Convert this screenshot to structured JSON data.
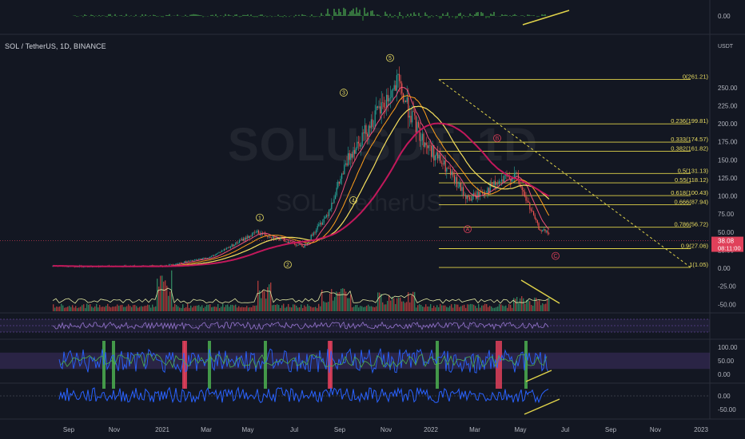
{
  "header": {
    "symbol_line": "SOL / TetherUS, 1D, BINANCE",
    "watermark_ticker": "SOLUSDT, 1D",
    "watermark_desc": "SOL / TetherUS",
    "currency": "USDT"
  },
  "colors": {
    "background": "#131722",
    "fib_line": "#e0d34a",
    "fib_label": "#e8dc62",
    "price_label_bg": "#e0405a",
    "candle_up": "#26a69a",
    "candle_down": "#ef5350",
    "ma_fast": "#f0507a",
    "ma_mid": "#ff9f1c",
    "ma_slow": "#f6e05e",
    "ma_long": "#c2185b",
    "oscillator_blue": "#2962ff",
    "oscillator_green": "#4caf50",
    "rsi_band": "#7e57c2"
  },
  "chart_data": [
    {
      "type": "line",
      "title": "SOL / TetherUS, 1D, BINANCE",
      "price_axis_ticks": [
        250,
        225,
        200,
        175,
        150,
        125,
        100,
        75,
        50,
        25,
        0,
        -25,
        -50
      ],
      "price_axis_tick_labels": [
        "250.00",
        "225.00",
        "200.00",
        "175.00",
        "150.00",
        "125.00",
        "100.00",
        "75.00",
        "50.00",
        "25.00",
        "0.00",
        "-25.00",
        "-50.00"
      ],
      "time_axis_labels": [
        "Sep",
        "Nov",
        "2021",
        "Mar",
        "May",
        "Jul",
        "Sep",
        "Nov",
        "2022",
        "Mar",
        "May",
        "Jul",
        "Sep",
        "Nov",
        "2023"
      ],
      "last_price": {
        "value": "38.08",
        "countdown": "08:11:00"
      },
      "price_series_approx": [
        {
          "date": "2020-08",
          "close": 3
        },
        {
          "date": "2020-10",
          "close": 2.5
        },
        {
          "date": "2021-01",
          "close": 3
        },
        {
          "date": "2021-03",
          "close": 15
        },
        {
          "date": "2021-05",
          "close": 50
        },
        {
          "date": "2021-07",
          "close": 30
        },
        {
          "date": "2021-08",
          "close": 75
        },
        {
          "date": "2021-09",
          "close": 160
        },
        {
          "date": "2021-11",
          "close": 255
        },
        {
          "date": "2021-12",
          "close": 180
        },
        {
          "date": "2022-01",
          "close": 140
        },
        {
          "date": "2022-02",
          "close": 95
        },
        {
          "date": "2022-04",
          "close": 130
        },
        {
          "date": "2022-05",
          "close": 55
        },
        {
          "date": "2022-06",
          "close": 38
        }
      ],
      "fibonacci_levels": [
        {
          "label": "0(261.21)",
          "price": 261.21
        },
        {
          "label": "0.236(199.81)",
          "price": 199.81
        },
        {
          "label": "0.333(174.57)",
          "price": 174.57
        },
        {
          "label": "0.382(161.82)",
          "price": 161.82
        },
        {
          "label": "0.5(131.13)",
          "price": 131.13
        },
        {
          "label": "0.55(118.12)",
          "price": 118.12
        },
        {
          "label": "0.618(100.43)",
          "price": 100.43
        },
        {
          "label": "0.666(87.94)",
          "price": 87.94
        },
        {
          "label": "0.786(56.72)",
          "price": 56.72
        },
        {
          "label": "0.9(27.06)",
          "price": 27.06
        },
        {
          "label": "1(1.05)",
          "price": 1.05
        }
      ],
      "wave_labels": [
        "1",
        "2",
        "3",
        "4",
        "5",
        "A",
        "B",
        "C"
      ]
    },
    {
      "type": "bar",
      "title": "",
      "top_panel_tick_labels": [
        "0.00"
      ]
    },
    {
      "type": "line",
      "title": "",
      "oscillator_tick_labels": [
        "100.00",
        "50.00",
        "0.00"
      ]
    },
    {
      "type": "line",
      "title": "",
      "momentum_tick_labels": [
        "0.00",
        "-50.00"
      ]
    }
  ]
}
